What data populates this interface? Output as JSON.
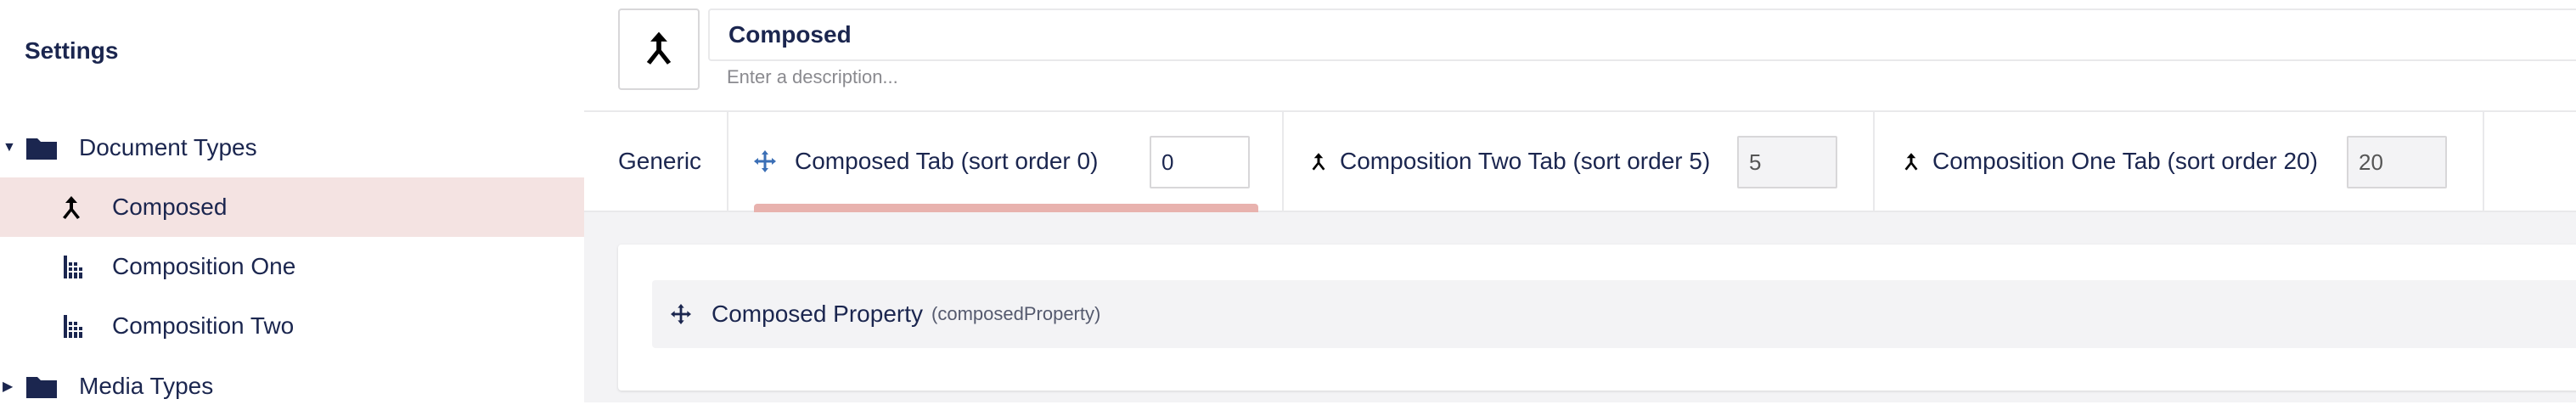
{
  "sidebar": {
    "title": "Settings",
    "tree": [
      {
        "label": "Document Types",
        "icon": "folder-icon",
        "expanded": true
      },
      {
        "label": "Composed",
        "icon": "merge-icon",
        "selected": true
      },
      {
        "label": "Composition One",
        "icon": "building-icon"
      },
      {
        "label": "Composition Two",
        "icon": "building-icon"
      },
      {
        "label": "Media Types",
        "icon": "folder-icon",
        "expanded": false
      }
    ]
  },
  "header": {
    "name": "Composed",
    "description_placeholder": "Enter a description...",
    "icon": "merge-icon"
  },
  "tabs": {
    "generic": "Generic",
    "items": [
      {
        "label": "Composed Tab (sort order 0)",
        "sort": "0",
        "icon": "move-icon",
        "active": true
      },
      {
        "label": "Composition Two Tab (sort order 5)",
        "sort": "5",
        "icon": "merge-icon"
      },
      {
        "label": "Composition One Tab (sort order 20)",
        "sort": "20",
        "icon": "merge-icon"
      }
    ]
  },
  "properties": [
    {
      "name": "Composed Property",
      "alias": "(composedProperty)",
      "icon": "move-icon"
    }
  ],
  "colors": {
    "accent_selected": "#f4e3e2",
    "tab_indicator": "#e8b2ae",
    "text": "#1b264f"
  }
}
